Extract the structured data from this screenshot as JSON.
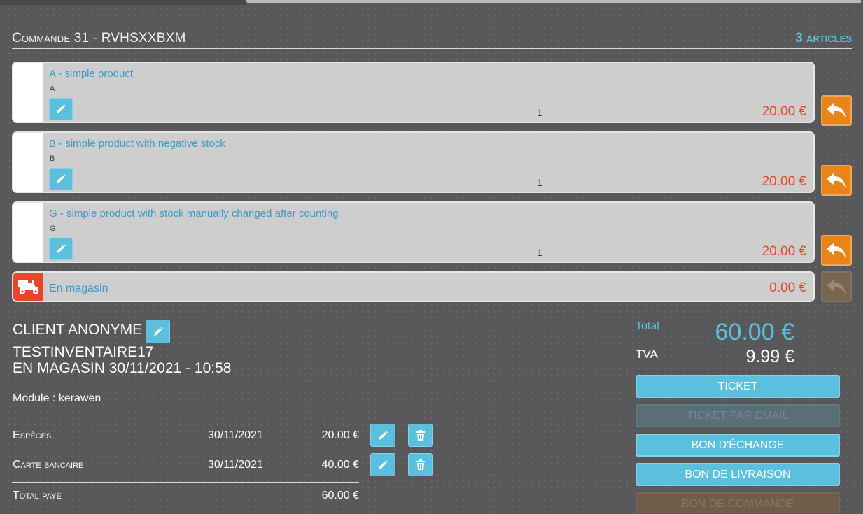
{
  "header": {
    "title": "Commande 31 - RVHSXXBXM",
    "count": "3 articles"
  },
  "lines": [
    {
      "name": "A - simple product",
      "ref": "A",
      "qty": "1",
      "price": "20.00 €"
    },
    {
      "name": "B - simple product with negative stock",
      "ref": "B",
      "qty": "1",
      "price": "20.00 €"
    },
    {
      "name": "G - simple product with stock manually changed after counting",
      "ref": "G",
      "qty": "1",
      "price": "20.00 €"
    }
  ],
  "shipping": {
    "name": "En magasin",
    "price": "0.00 €"
  },
  "client": {
    "name": "CLIENT ANONYME",
    "seller": "TESTINVENTAIRE17",
    "location": "EN MAGASIN 30/11/2021 - 10:58",
    "module": "Module : kerawen"
  },
  "payments": [
    {
      "method": "Espèces",
      "date": "30/11/2021",
      "amount": "20.00 €"
    },
    {
      "method": "Carte bancaire",
      "date": "30/11/2021",
      "amount": "40.00 €"
    }
  ],
  "total_paid": {
    "label": "Total payé",
    "value": "60.00 €"
  },
  "totals": {
    "total_label": "Total",
    "total_value": "60.00 €",
    "tva_label": "TVA",
    "tva_value": "9.99 €"
  },
  "actions": {
    "ticket": "TICKET",
    "ticket_email": "TICKET PAR EMAIL",
    "bon_echange": "BON D'ÉCHANGE",
    "bon_livraison": "BON DE LIVRAISON",
    "bon_commande": "BON DE COMMANDE"
  },
  "colors": {
    "accent": "#5bc0de",
    "price": "#e8462a",
    "return": "#e8841a",
    "background": "#58585a"
  }
}
